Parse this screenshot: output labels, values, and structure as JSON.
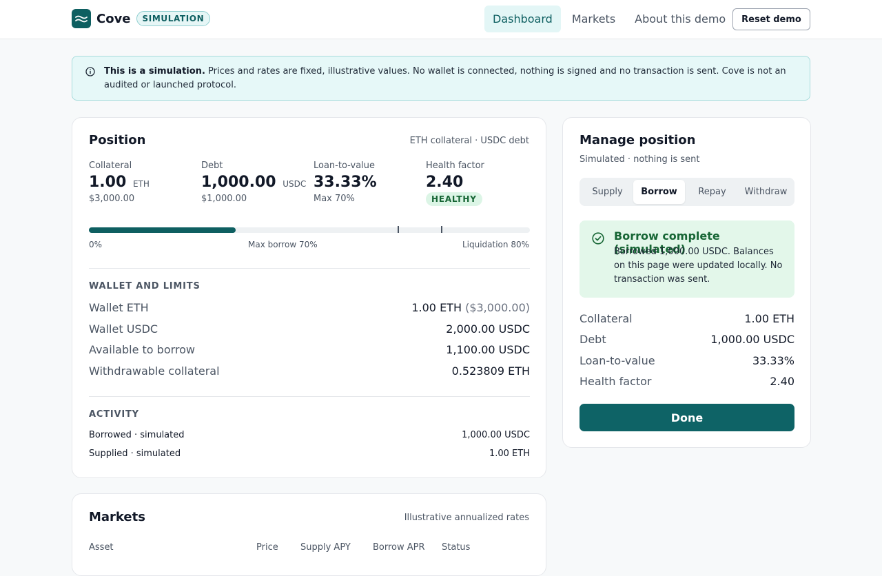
{
  "header": {
    "brand": "Cove",
    "badge": "SIMULATION",
    "nav": [
      {
        "label": "Dashboard",
        "active": true
      },
      {
        "label": "Markets",
        "active": false
      },
      {
        "label": "About this demo",
        "active": false
      }
    ],
    "reset_label": "Reset demo"
  },
  "notice": {
    "bold": "This is a simulation.",
    "text": " Prices and rates are fixed, illustrative values. No wallet is connected, nothing is signed and no transaction is sent. Cove is not an audited or launched protocol."
  },
  "position": {
    "title": "Position",
    "meta": "ETH collateral · USDC debt",
    "stats": {
      "collateral": {
        "label": "Collateral",
        "value": "1.00",
        "unit": "ETH",
        "sub": "$3,000.00"
      },
      "debt": {
        "label": "Debt",
        "value": "1,000.00",
        "unit": "USDC",
        "sub": "$1,000.00"
      },
      "ltv": {
        "label": "Loan-to-value",
        "value": "33.33%",
        "sub": "Max 70%"
      },
      "health": {
        "label": "Health factor",
        "value": "2.40",
        "status": "HEALTHY"
      }
    },
    "ltv_bar": {
      "current_ltv_percent": 33.33,
      "labels": {
        "start": "0%",
        "max": "Max borrow 70%",
        "liquidation": "Liquidation 80%"
      }
    },
    "wallet_section": "WALLET AND LIMITS",
    "wallet": [
      {
        "key": "Wallet ETH",
        "value": "1.00 ETH",
        "muted": "($3,000.00)"
      },
      {
        "key": "Wallet USDC",
        "value": "2,000.00 USDC"
      },
      {
        "key": "Available to borrow",
        "value": "1,100.00 USDC"
      },
      {
        "key": "Withdrawable collateral",
        "value": "0.523809 ETH"
      }
    ],
    "activity_section": "ACTIVITY",
    "activity": [
      {
        "label": "Borrowed · simulated",
        "value": "1,000.00 USDC"
      },
      {
        "label": "Supplied · simulated",
        "value": "1.00 ETH"
      }
    ]
  },
  "manage": {
    "title": "Manage position",
    "subtitle": "Simulated · nothing is sent",
    "tabs": [
      {
        "label": "Supply",
        "active": false
      },
      {
        "label": "Borrow",
        "active": true
      },
      {
        "label": "Repay",
        "active": false
      },
      {
        "label": "Withdraw",
        "active": false
      }
    ],
    "success_title": "Borrow complete (simulated)",
    "success_text": "Borrowed 1,000.00 USDC. Balances on this page were updated locally. No transaction was sent.",
    "summary": [
      {
        "key": "Collateral",
        "value": "1.00 ETH"
      },
      {
        "key": "Debt",
        "value": "1,000.00 USDC"
      },
      {
        "key": "Loan-to-value",
        "value": "33.33%"
      },
      {
        "key": "Health factor",
        "value": "2.40"
      }
    ],
    "done_label": "Done"
  },
  "markets": {
    "title": "Markets",
    "meta": "Illustrative annualized rates",
    "columns": [
      "Asset",
      "Price",
      "Supply APY",
      "Borrow APR",
      "Status"
    ]
  },
  "colors": {
    "accent": "#0e5f61",
    "success": "#166534",
    "notice_bg": "#e6f8f8"
  }
}
